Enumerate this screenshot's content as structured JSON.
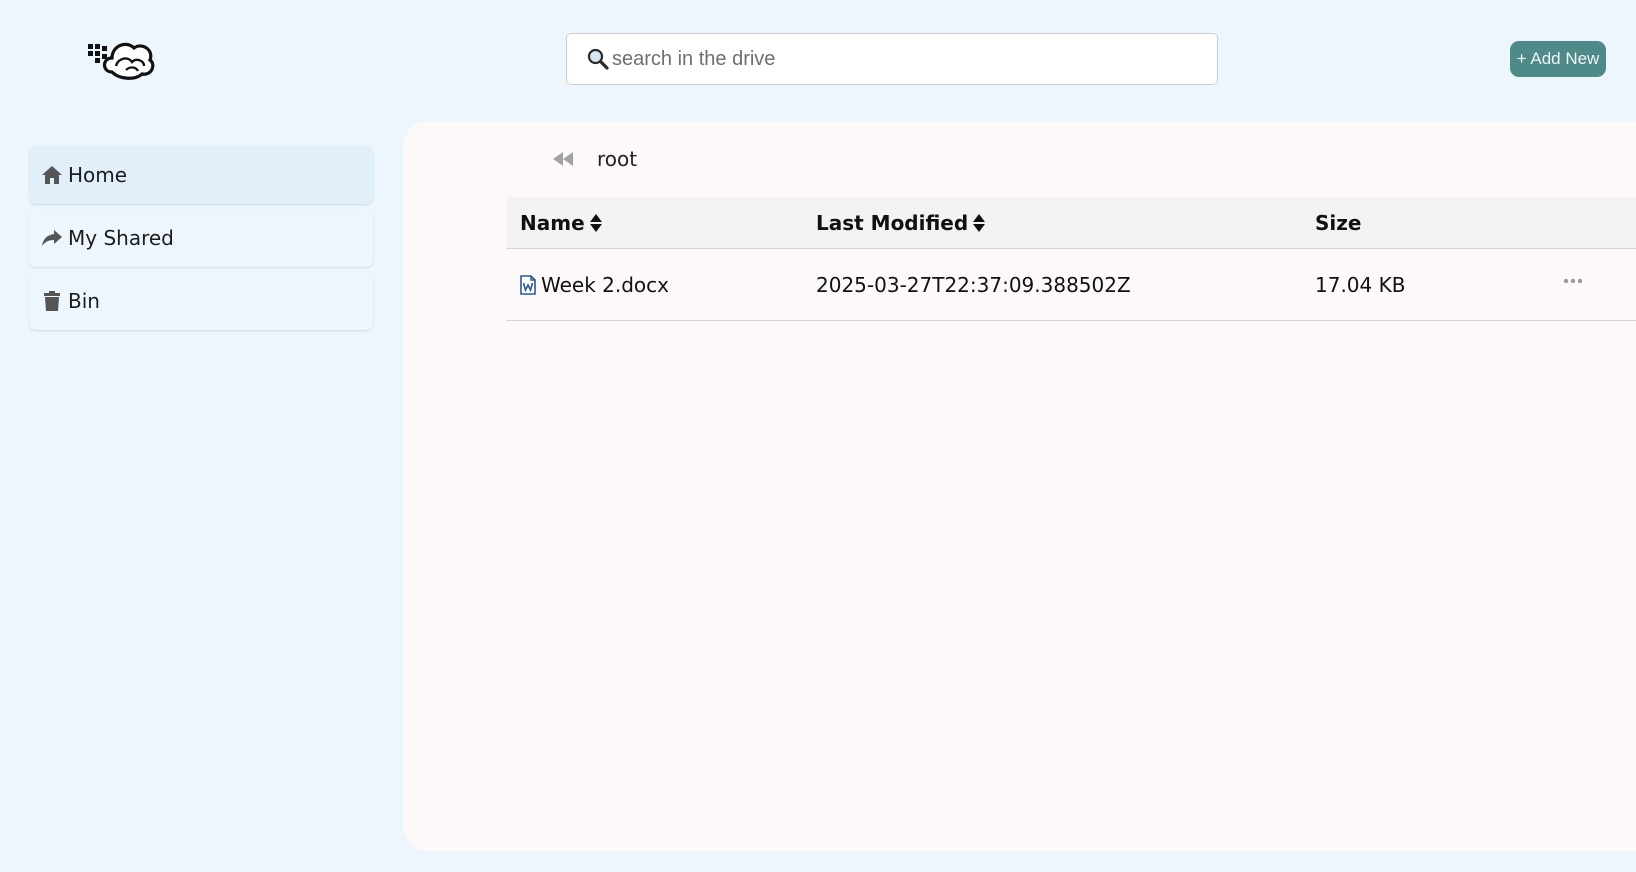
{
  "header": {
    "logo_icon": "cloud-logo-icon",
    "search": {
      "placeholder": "search in the drive",
      "value": ""
    },
    "add_new_label": "+ Add New",
    "accent_color": "#4e8a88"
  },
  "sidebar": {
    "items": [
      {
        "label": "Home",
        "icon": "home-icon",
        "active": true
      },
      {
        "label": "My Shared",
        "icon": "share-icon",
        "active": false
      },
      {
        "label": "Bin",
        "icon": "trash-icon",
        "active": false
      }
    ]
  },
  "main": {
    "breadcrumb": {
      "back_icon": "double-chevron-left-icon",
      "path": "root"
    },
    "table": {
      "columns": [
        {
          "label": "Name",
          "sortable": true
        },
        {
          "label": "Last Modified",
          "sortable": true
        },
        {
          "label": "Size",
          "sortable": false
        }
      ],
      "rows": [
        {
          "icon": "word-document-icon",
          "name": "Week 2.docx",
          "modified": "2025-03-27T22:37:09.388502Z",
          "size": "17.04 KB",
          "actions_icon": "more-horizontal-icon"
        }
      ]
    }
  }
}
